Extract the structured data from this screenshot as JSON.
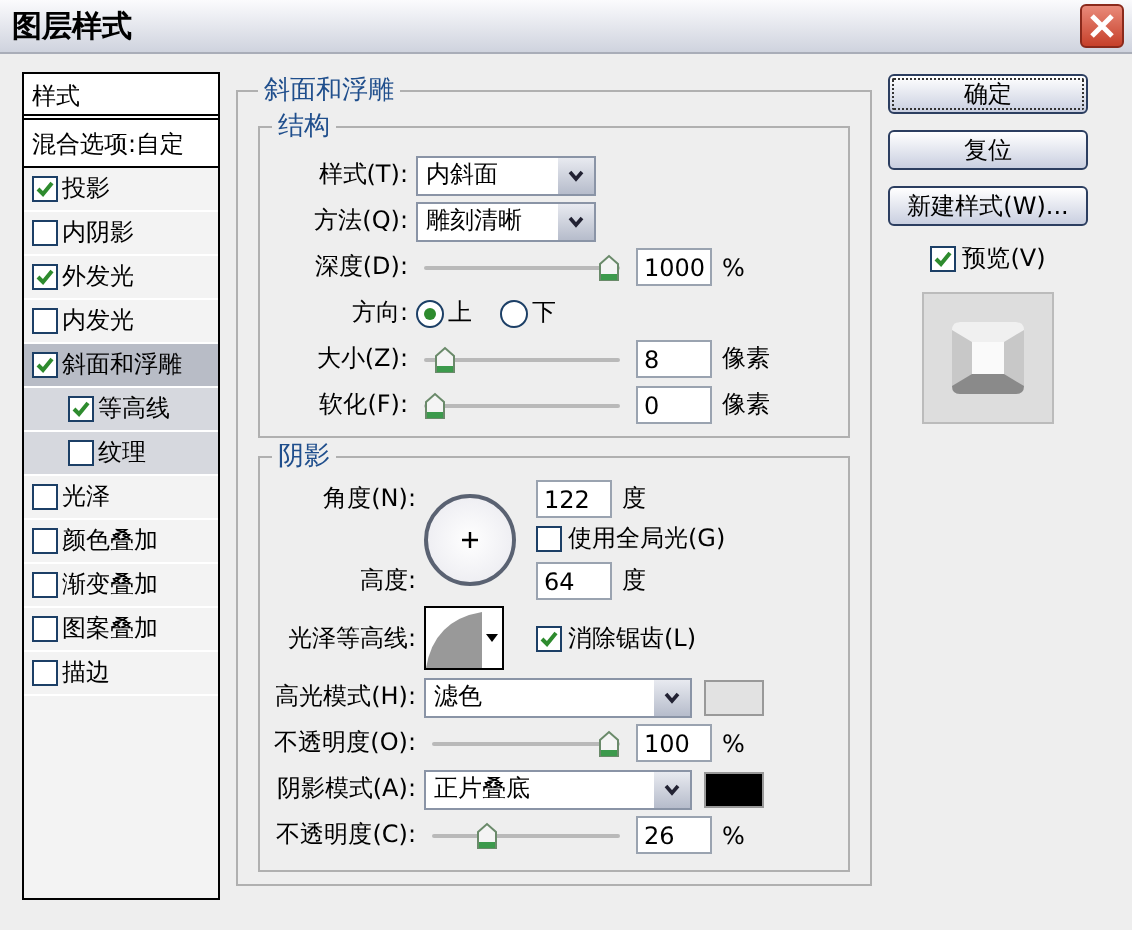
{
  "window": {
    "title": "图层样式"
  },
  "styles_list": {
    "header": "样式",
    "blend": "混合选项:自定",
    "items": [
      {
        "label": "投影",
        "checked": true,
        "selected": false
      },
      {
        "label": "内阴影",
        "checked": false,
        "selected": false
      },
      {
        "label": "外发光",
        "checked": true,
        "selected": false
      },
      {
        "label": "内发光",
        "checked": false,
        "selected": false
      },
      {
        "label": "斜面和浮雕",
        "checked": true,
        "selected": true,
        "children": [
          {
            "label": "等高线",
            "checked": true,
            "selected": false
          },
          {
            "label": "纹理",
            "checked": false,
            "selected": false
          }
        ]
      },
      {
        "label": "光泽",
        "checked": false,
        "selected": false
      },
      {
        "label": "颜色叠加",
        "checked": false,
        "selected": false
      },
      {
        "label": "渐变叠加",
        "checked": false,
        "selected": false
      },
      {
        "label": "图案叠加",
        "checked": false,
        "selected": false
      },
      {
        "label": "描边",
        "checked": false,
        "selected": false
      }
    ]
  },
  "bevel": {
    "title": "斜面和浮雕",
    "structure": {
      "title": "结构",
      "rows": [
        {
          "kind": "select",
          "label": "样式(T):",
          "value": "内斜面"
        },
        {
          "kind": "select",
          "label": "方法(Q):",
          "value": "雕刻清晰"
        },
        {
          "kind": "slider",
          "label": "深度(D):",
          "level": 1,
          "value": "1000",
          "unit": "%"
        },
        {
          "kind": "radio",
          "label": "方向:",
          "options": [
            {
              "label": "上",
              "selected": true
            },
            {
              "label": "下",
              "selected": false
            }
          ]
        },
        {
          "kind": "slider",
          "label": "大小(Z):",
          "level": 0.06,
          "value": "8",
          "unit": "像素"
        },
        {
          "kind": "slider",
          "label": "软化(F):",
          "level": 0,
          "value": "0",
          "unit": "像素"
        }
      ]
    },
    "shading": {
      "title": "阴影",
      "angle": {
        "label": "角度(N):",
        "value": "122",
        "unit": "度"
      },
      "global_light": {
        "label": "使用全局光(G)",
        "checked": false
      },
      "altitude": {
        "label": "高度:",
        "value": "64",
        "unit": "度"
      },
      "gloss_contour": {
        "label": "光泽等高线:"
      },
      "anti_alias": {
        "label": "消除锯齿(L)",
        "checked": true
      },
      "rows": [
        {
          "kind": "select",
          "label": "高光模式(H):",
          "value": "滤色",
          "color": "#e2e2e2"
        },
        {
          "kind": "slider",
          "label": "不透明度(O):",
          "level": 1,
          "value": "100",
          "unit": "%"
        },
        {
          "kind": "select",
          "label": "阴影模式(A):",
          "value": "正片叠底",
          "color": "#000000"
        },
        {
          "kind": "slider",
          "label": "不透明度(C):",
          "level": 0.26,
          "value": "26",
          "unit": "%"
        }
      ]
    }
  },
  "buttons": [
    {
      "label": "确定",
      "kind": "default"
    },
    {
      "label": "复位",
      "kind": "normal"
    },
    {
      "label": "新建样式(W)...",
      "kind": "normal"
    }
  ],
  "preview": {
    "label": "预览(V)",
    "checked": true
  }
}
